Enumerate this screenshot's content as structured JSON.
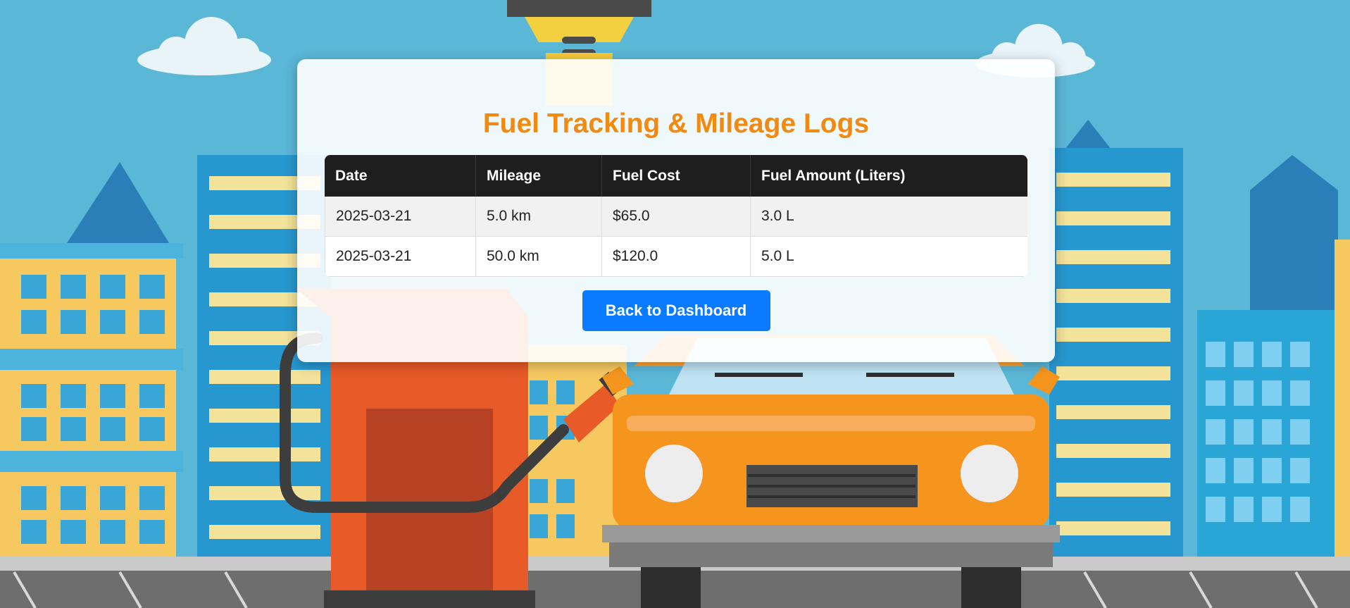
{
  "page": {
    "title": "Fuel Tracking & Mileage Logs"
  },
  "table": {
    "columns": [
      "Date",
      "Mileage",
      "Fuel Cost",
      "Fuel Amount (Liters)"
    ],
    "rows": [
      [
        "2025-03-21",
        "5.0 km",
        "$65.0",
        "3.0 L"
      ],
      [
        "2025-03-21",
        "50.0 km",
        "$120.0",
        "5.0 L"
      ]
    ]
  },
  "actions": {
    "back_label": "Back to Dashboard"
  },
  "colors": {
    "title": "#f28a12",
    "header_bg": "#1e1e1e",
    "button_bg": "#0a7bff",
    "sky": "#5ab7d6"
  },
  "background": {
    "scene": "gas-station-illustration"
  }
}
